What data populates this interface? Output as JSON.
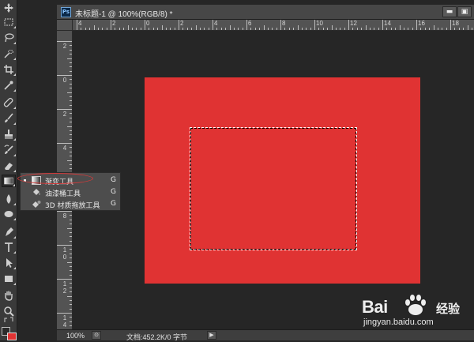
{
  "document": {
    "app_badge": "Ps",
    "title": "未标题-1 @ 100%(RGB/8) *",
    "minimize": "▬",
    "maximize": "▣"
  },
  "rulers": {
    "horizontal": [
      "4",
      "2",
      "0",
      "2",
      "4",
      "6",
      "8",
      "10",
      "12",
      "14",
      "16",
      "18"
    ],
    "vertical": [
      "2",
      "0",
      "2",
      "4",
      "6",
      "8",
      "10",
      "12",
      "14"
    ]
  },
  "flyout_menu": {
    "items": [
      {
        "label": "渐变工具",
        "key": "G",
        "selected": true
      },
      {
        "label": "油漆桶工具",
        "key": "G",
        "selected": false
      },
      {
        "label": "3D 材质拖放工具",
        "key": "G",
        "selected": false
      }
    ]
  },
  "status_bar": {
    "zoom": "100%",
    "doc_info": "文档:452.2K/0 字节",
    "arrow": "▶"
  },
  "colors": {
    "artboard": "#e03333",
    "foreground": "#2b2b2b",
    "background": "#e03333"
  },
  "watermark": {
    "brand": "Bai",
    "brand_cn": "经验",
    "url": "jingyan.baidu.com"
  }
}
